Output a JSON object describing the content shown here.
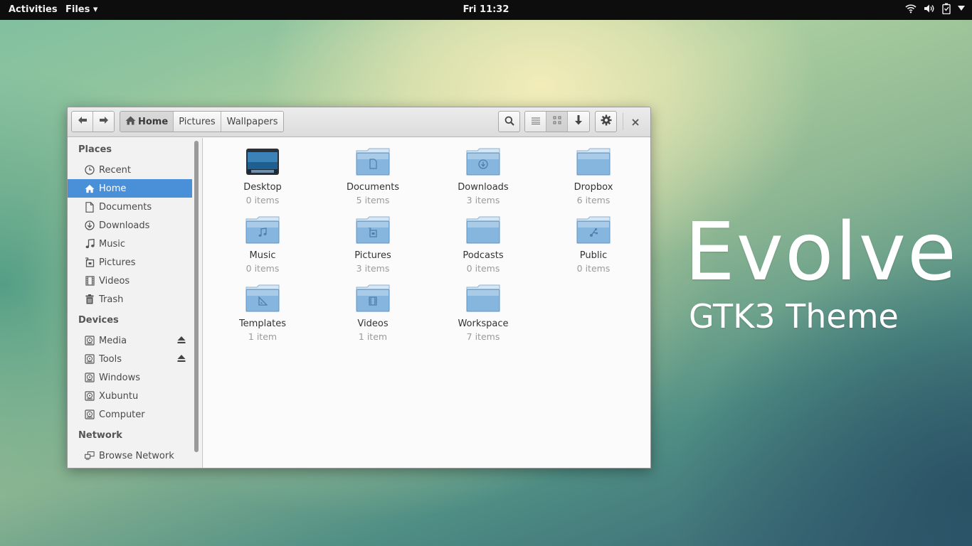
{
  "topbar": {
    "activities": "Activities",
    "app_menu": "Files ▾",
    "clock": "Fri 11:32",
    "tray_icons": [
      "wifi-icon",
      "volume-icon",
      "battery-icon",
      "system-menu-arrow-icon"
    ]
  },
  "window": {
    "breadcrumb": [
      {
        "label": "Home",
        "icon": "home-icon",
        "active": true
      },
      {
        "label": "Pictures",
        "active": false
      },
      {
        "label": "Wallpapers",
        "active": false
      }
    ],
    "toolbar_icons": [
      "back-arrow-icon",
      "forward-arrow-icon",
      "search-icon",
      "list-view-icon",
      "grid-view-icon",
      "sort-down-icon",
      "gear-icon",
      "close-icon"
    ],
    "view_mode": "grid"
  },
  "sidebar": {
    "places_heading": "Places",
    "places": [
      {
        "label": "Recent",
        "icon": "clock-icon"
      },
      {
        "label": "Home",
        "icon": "home-icon",
        "selected": true
      },
      {
        "label": "Documents",
        "icon": "document-icon"
      },
      {
        "label": "Downloads",
        "icon": "download-icon"
      },
      {
        "label": "Music",
        "icon": "music-icon"
      },
      {
        "label": "Pictures",
        "icon": "pictures-icon"
      },
      {
        "label": "Videos",
        "icon": "film-icon"
      },
      {
        "label": "Trash",
        "icon": "trash-icon"
      }
    ],
    "devices_heading": "Devices",
    "devices": [
      {
        "label": "Media",
        "icon": "drive-icon",
        "eject": true
      },
      {
        "label": "Tools",
        "icon": "drive-icon",
        "eject": true
      },
      {
        "label": "Windows",
        "icon": "drive-icon",
        "eject": false
      },
      {
        "label": "Xubuntu",
        "icon": "drive-icon",
        "eject": false
      },
      {
        "label": "Computer",
        "icon": "drive-icon",
        "eject": false
      }
    ],
    "network_heading": "Network",
    "network": [
      {
        "label": "Browse Network",
        "icon": "network-icon"
      }
    ]
  },
  "files": [
    {
      "name": "Desktop",
      "count": "0 items",
      "icon": "desktop-folder-icon"
    },
    {
      "name": "Documents",
      "count": "5 items",
      "icon": "documents-folder-icon"
    },
    {
      "name": "Downloads",
      "count": "3 items",
      "icon": "downloads-folder-icon"
    },
    {
      "name": "Dropbox",
      "count": "6 items",
      "icon": "folder-icon"
    },
    {
      "name": "Music",
      "count": "0 items",
      "icon": "music-folder-icon"
    },
    {
      "name": "Pictures",
      "count": "3 items",
      "icon": "pictures-folder-icon"
    },
    {
      "name": "Podcasts",
      "count": "0 items",
      "icon": "folder-icon"
    },
    {
      "name": "Public",
      "count": "0 items",
      "icon": "public-folder-icon"
    },
    {
      "name": "Templates",
      "count": "1 item",
      "icon": "templates-folder-icon"
    },
    {
      "name": "Videos",
      "count": "1 item",
      "icon": "videos-folder-icon"
    },
    {
      "name": "Workspace",
      "count": "7 items",
      "icon": "folder-icon"
    }
  ],
  "brand": {
    "title": "Evolve",
    "subtitle": "GTK3 Theme"
  },
  "colors": {
    "selection": "#4a90d9",
    "folder_light": "#a9cbe8",
    "folder_dark": "#5f97c8",
    "topbar": "#0d0d0d"
  }
}
